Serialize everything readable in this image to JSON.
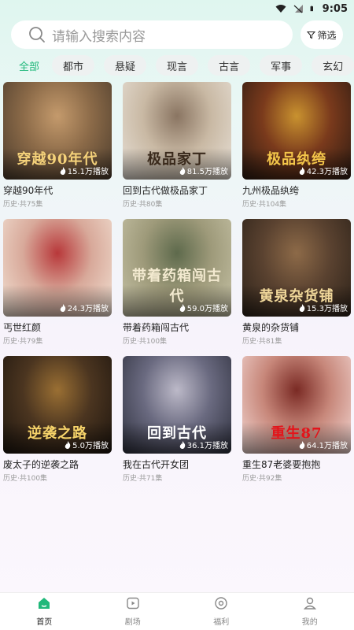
{
  "status_bar": {
    "time": "9:05"
  },
  "search": {
    "placeholder": "请输入搜索内容",
    "filter_label": "筛选"
  },
  "tabs": [
    {
      "label": "全部",
      "active": true
    },
    {
      "label": "都市"
    },
    {
      "label": "悬疑"
    },
    {
      "label": "现言"
    },
    {
      "label": "古言"
    },
    {
      "label": "军事"
    },
    {
      "label": "玄幻"
    }
  ],
  "cards": [
    {
      "title": "穿越90年代",
      "meta": "历史·共75集",
      "plays": "15.1万播放",
      "caption": "穿越90年代",
      "colors": [
        "#4a3b2c",
        "#8b6a48",
        "#c49a6c"
      ],
      "caption_color": "#f5d27a"
    },
    {
      "title": "回到古代做极品家丁",
      "meta": "历史·共80集",
      "plays": "81.5万播放",
      "caption": "极品家丁",
      "colors": [
        "#e8e1d8",
        "#c9b9a4",
        "#8a7562"
      ],
      "caption_color": "#3a2a1c"
    },
    {
      "title": "九州极品纨绔",
      "meta": "历史·共104集",
      "plays": "42.3万播放",
      "caption": "极品纨绔",
      "colors": [
        "#2a1a12",
        "#7a3a1c",
        "#c9922f"
      ],
      "caption_color": "#f4c64a"
    },
    {
      "title": "丐世红颜",
      "meta": "历史·共79集",
      "plays": "24.3万播放",
      "caption": "",
      "colors": [
        "#f3e4d6",
        "#d8a99a",
        "#b8383a"
      ],
      "caption_color": "#7a1d1d"
    },
    {
      "title": "带着药箱闯古代",
      "meta": "历史·共100集",
      "plays": "59.0万播放",
      "caption": "带着药箱闯古代",
      "colors": [
        "#c8c4a8",
        "#9e9a7a",
        "#5e6a4c"
      ],
      "caption_color": "#f3ead0"
    },
    {
      "title": "黄泉的杂货铺",
      "meta": "历史·共81集",
      "plays": "15.3万播放",
      "caption": "黄泉杂货铺",
      "colors": [
        "#2b2118",
        "#5a4230",
        "#8d6a48"
      ],
      "caption_color": "#f0d79a"
    },
    {
      "title": "废太子的逆袭之路",
      "meta": "历史·共100集",
      "plays": "5.0万播放",
      "caption": "逆袭之路",
      "colors": [
        "#1c140e",
        "#4b3520",
        "#9a6f33"
      ],
      "caption_color": "#f6d36a"
    },
    {
      "title": "我在古代开女团",
      "meta": "历史·共71集",
      "plays": "36.1万播放",
      "caption": "回到古代",
      "colors": [
        "#2d2f3c",
        "#6a6a80",
        "#bcb9c8"
      ],
      "caption_color": "#ffffff"
    },
    {
      "title": "重生87老婆要抱抱",
      "meta": "历史·共92集",
      "plays": "64.1万播放",
      "caption": "重生87",
      "colors": [
        "#f4dad6",
        "#c7877a",
        "#7a2a24"
      ],
      "caption_color": "#e3141a"
    }
  ],
  "bottom_nav": [
    {
      "label": "首页",
      "icon": "home-icon",
      "active": true
    },
    {
      "label": "剧场",
      "icon": "theater-icon"
    },
    {
      "label": "福利",
      "icon": "welfare-icon"
    },
    {
      "label": "我的",
      "icon": "profile-icon"
    }
  ],
  "colors": {
    "accent": "#20b87a",
    "muted": "#9a9a9a"
  }
}
